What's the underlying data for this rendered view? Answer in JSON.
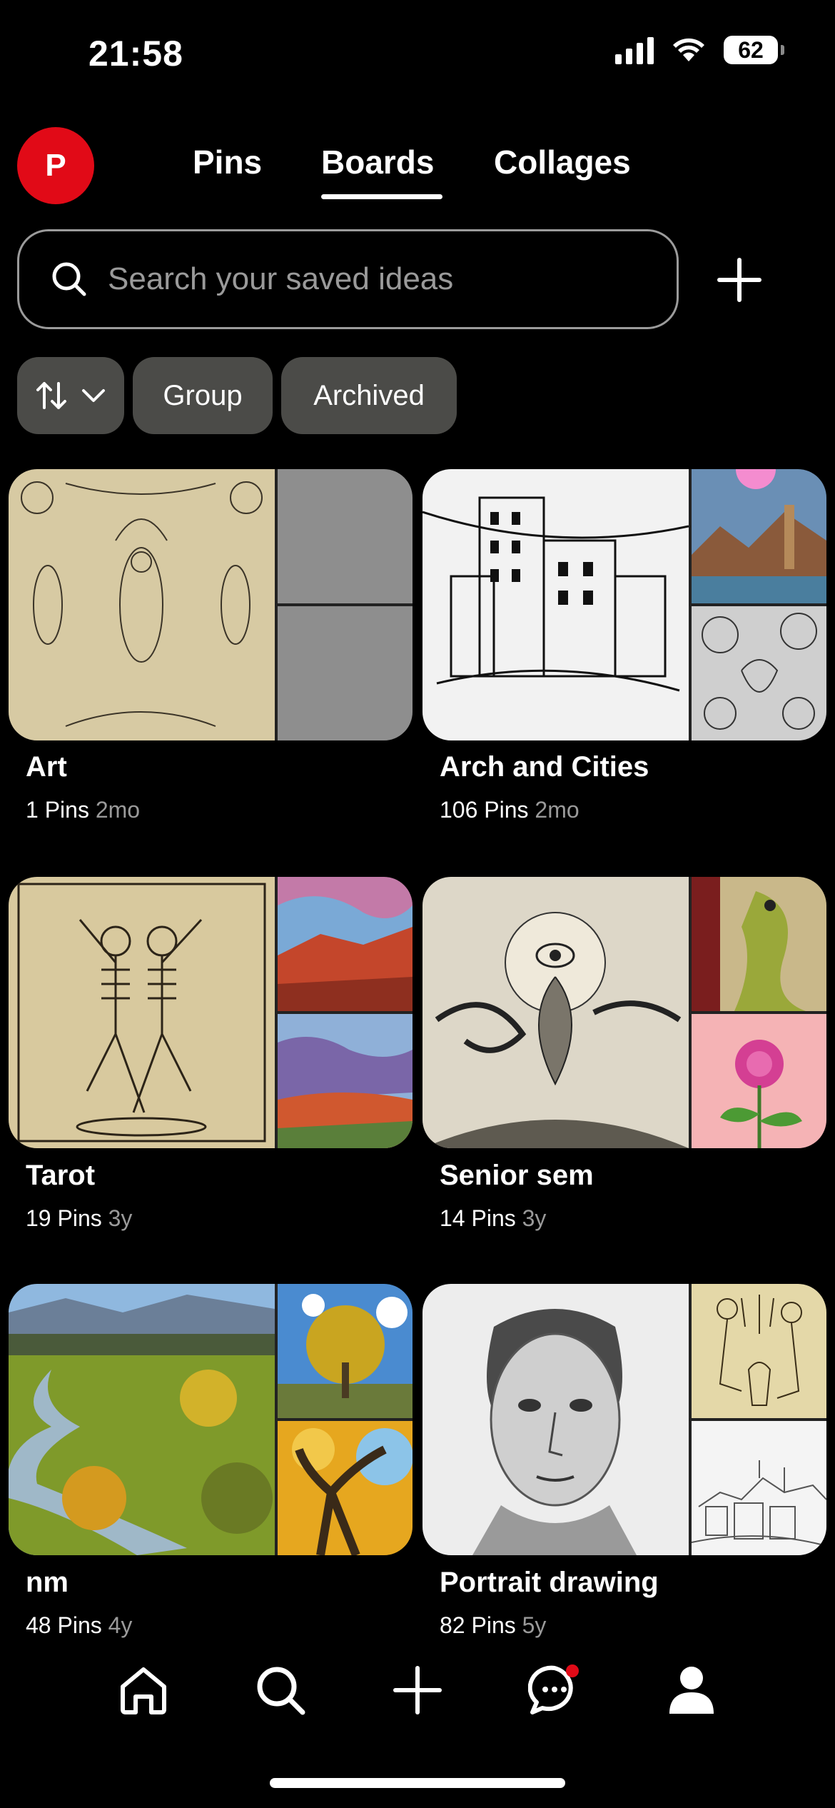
{
  "status_bar": {
    "time": "21:58",
    "battery": "62"
  },
  "header": {
    "avatar_initial": "P",
    "tabs": [
      {
        "label": "Pins"
      },
      {
        "label": "Boards",
        "active": true
      },
      {
        "label": "Collages"
      }
    ]
  },
  "search": {
    "placeholder": "Search your saved ideas"
  },
  "filters": {
    "group": "Group",
    "archived": "Archived"
  },
  "boards": [
    {
      "title": "Art",
      "pins": "1 Pins",
      "age": "2mo"
    },
    {
      "title": "Arch and Cities",
      "pins": "106 Pins",
      "age": "2mo"
    },
    {
      "title": "Tarot",
      "pins": "19 Pins",
      "age": "3y"
    },
    {
      "title": "Senior sem",
      "pins": "14 Pins",
      "age": "3y"
    },
    {
      "title": "nm",
      "pins": "48 Pins",
      "age": "4y"
    },
    {
      "title": "Portrait drawing",
      "pins": "82 Pins",
      "age": "5y"
    }
  ],
  "colors": {
    "background": "#000000",
    "brand_red": "#e10a17",
    "chip": "#4b4b48",
    "muted_text": "#9a9a9a"
  },
  "icons": {
    "nav": [
      "home-icon",
      "search-icon",
      "plus-icon",
      "messages-icon",
      "profile-icon"
    ]
  }
}
